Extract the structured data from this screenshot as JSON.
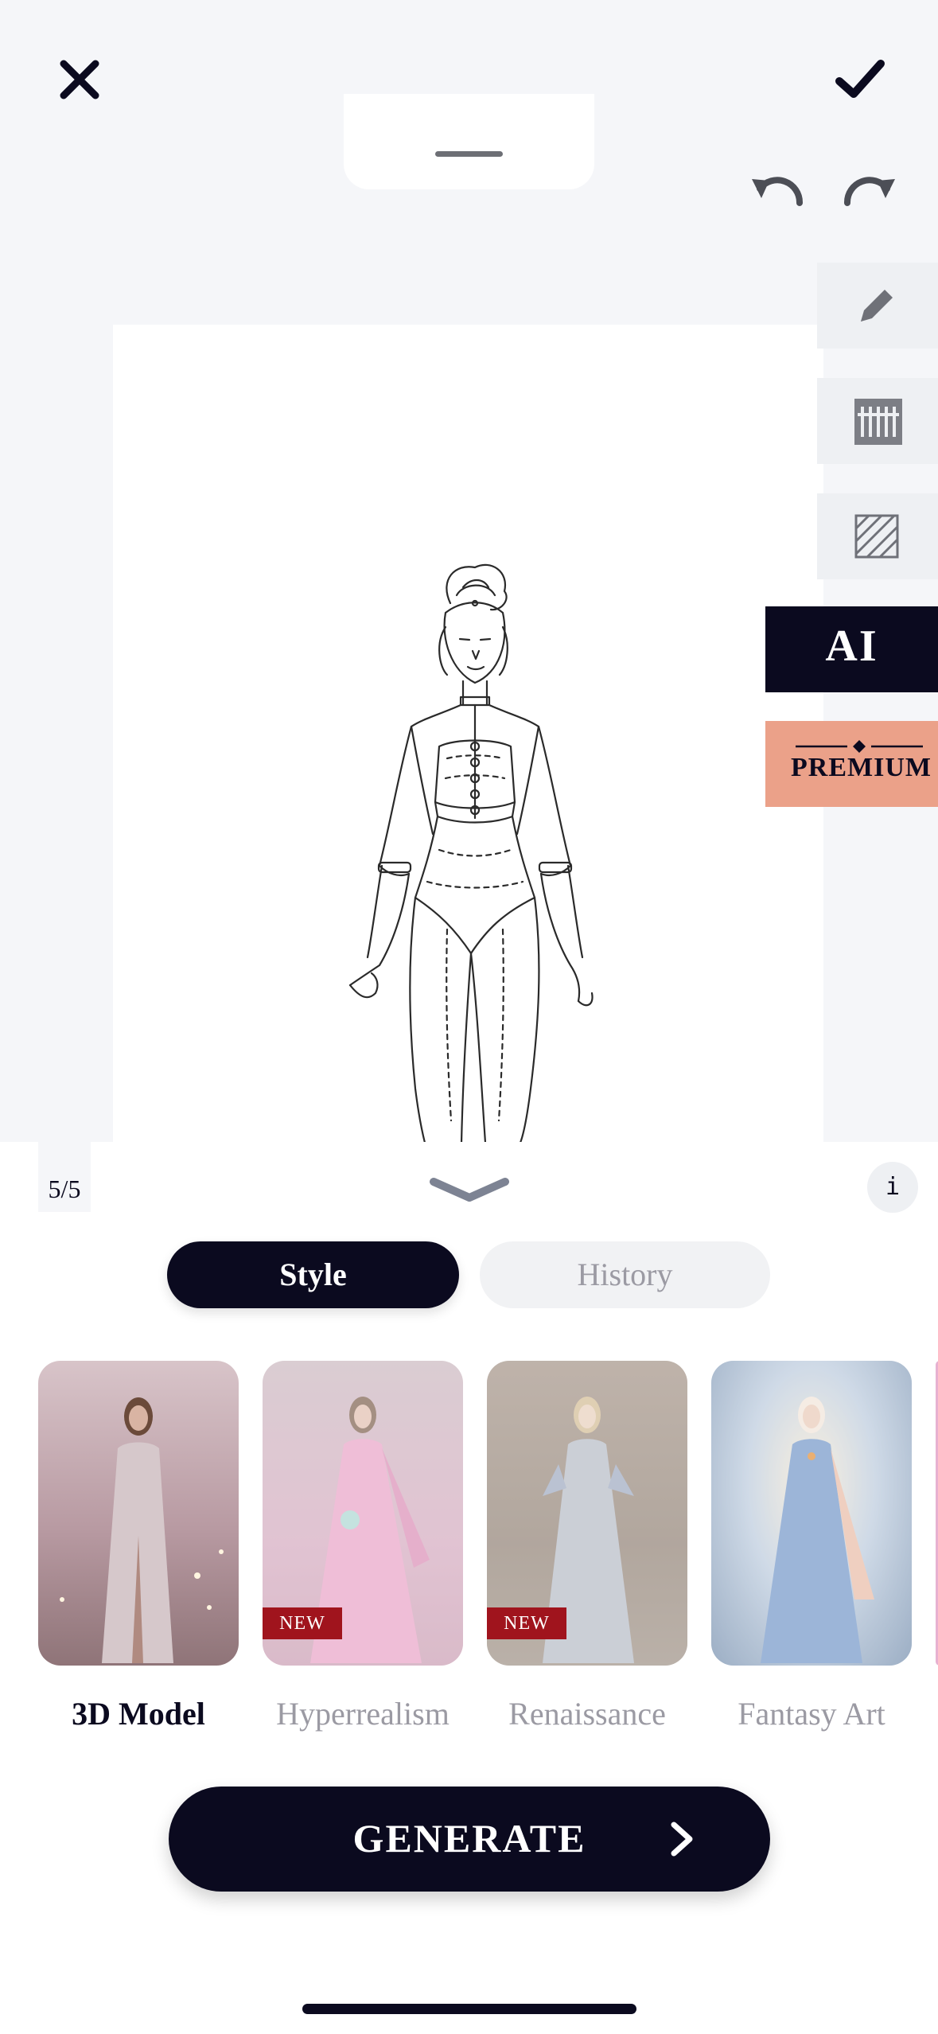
{
  "header": {
    "close_icon": "close-icon",
    "confirm_icon": "checkmark-icon",
    "undo_icon": "undo-icon",
    "redo_icon": "redo-icon"
  },
  "tools": {
    "items": [
      {
        "name": "pencil",
        "icon": "pencil-icon"
      },
      {
        "name": "fabric",
        "icon": "fabric-icon"
      },
      {
        "name": "pattern",
        "icon": "hatch-pattern-icon"
      }
    ],
    "ai_label": "AI",
    "premium_label": "PREMIUM"
  },
  "sheet": {
    "counter": "5/5",
    "info_label": "i",
    "tabs": {
      "style": "Style",
      "history": "History"
    },
    "styles": [
      {
        "label": "3D Model",
        "badge": "",
        "selected": true
      },
      {
        "label": "Hyperrealism",
        "badge": "NEW",
        "selected": false
      },
      {
        "label": "Renaissance",
        "badge": "NEW",
        "selected": false
      },
      {
        "label": "Fantasy Art",
        "badge": "",
        "selected": false
      }
    ],
    "generate_label": "GENERATE"
  },
  "colors": {
    "primary": "#0b0a1f",
    "premium": "#eba189",
    "badge": "#a0141d",
    "muted_text": "#9b9aa3"
  }
}
